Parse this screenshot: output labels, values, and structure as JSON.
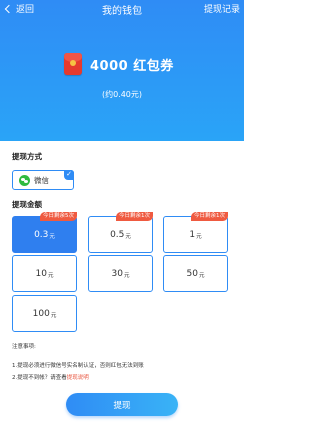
{
  "header": {
    "back_label": "返回",
    "title": "我的钱包",
    "record_label": "提现记录",
    "balance_text": "4000 红包券",
    "approx_text": "(约0.40元)"
  },
  "withdraw_method": {
    "label": "提现方式",
    "option": "微信"
  },
  "amounts": {
    "label": "提现金额",
    "unit": "元",
    "items": [
      {
        "value": "0.3",
        "badge": "今日剩余5次",
        "selected": true
      },
      {
        "value": "0.5",
        "badge": "今日剩余1次",
        "selected": false
      },
      {
        "value": "1",
        "badge": "今日剩余1次",
        "selected": false
      },
      {
        "value": "10",
        "badge": "",
        "selected": false
      },
      {
        "value": "30",
        "badge": "",
        "selected": false
      },
      {
        "value": "50",
        "badge": "",
        "selected": false
      },
      {
        "value": "100",
        "badge": "",
        "selected": false
      }
    ]
  },
  "notes": {
    "title": "注意事项:",
    "line1": "1.提现必须进行微信号实名制认证，否则红包无法到账",
    "line2_prefix": "2.提现不到帐？请查看",
    "line2_link": "提现说明"
  },
  "submit_label": "提现",
  "colors": {
    "primary": "#2f8cf5",
    "badge": "#ef5a40",
    "wechat": "#2fba3f"
  }
}
